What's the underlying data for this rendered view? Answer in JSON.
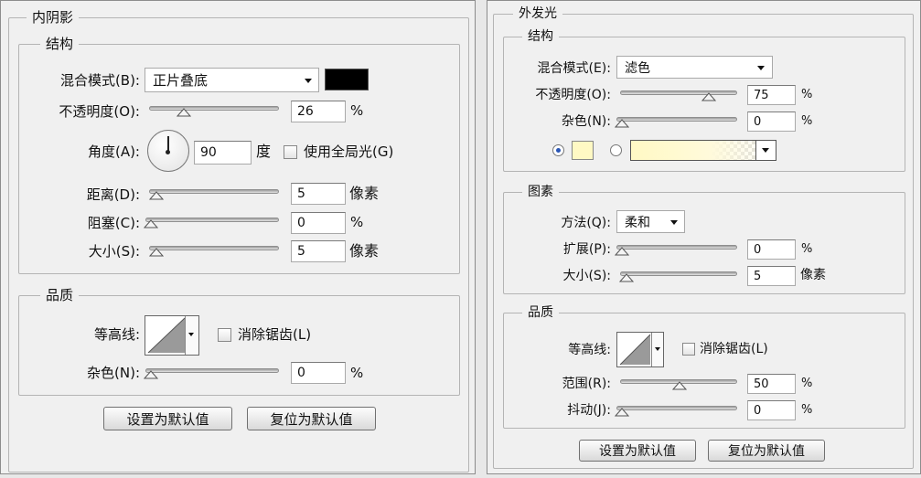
{
  "inner_shadow": {
    "title": "内阴影",
    "structure": {
      "title": "结构",
      "blend_mode_label": "混合模式(B):",
      "blend_mode_value": "正片叠底",
      "shadow_color": "#000000",
      "opacity_label": "不透明度(O):",
      "opacity_value": "26",
      "opacity_unit": "%",
      "angle_label": "角度(A):",
      "angle_value": "90",
      "angle_unit": "度",
      "global_light_label": "使用全局光(G)",
      "distance_label": "距离(D):",
      "distance_value": "5",
      "distance_unit": "像素",
      "choke_label": "阻塞(C):",
      "choke_value": "0",
      "choke_unit": "%",
      "size_label": "大小(S):",
      "size_value": "5",
      "size_unit": "像素"
    },
    "quality": {
      "title": "品质",
      "contour_label": "等高线:",
      "anti_alias_label": "消除锯齿(L)",
      "noise_label": "杂色(N):",
      "noise_value": "0",
      "noise_unit": "%"
    },
    "buttons": {
      "make_default": "设置为默认值",
      "reset_default": "复位为默认值"
    }
  },
  "outer_glow": {
    "title": "外发光",
    "structure": {
      "title": "结构",
      "blend_mode_label": "混合模式(E):",
      "blend_mode_value": "滤色",
      "opacity_label": "不透明度(O):",
      "opacity_value": "75",
      "opacity_unit": "%",
      "noise_label": "杂色(N):",
      "noise_value": "0",
      "noise_unit": "%",
      "glow_color": "#fff9c4"
    },
    "elements": {
      "title": "图素",
      "technique_label": "方法(Q):",
      "technique_value": "柔和",
      "spread_label": "扩展(P):",
      "spread_value": "0",
      "spread_unit": "%",
      "size_label": "大小(S):",
      "size_value": "5",
      "size_unit": "像素"
    },
    "quality": {
      "title": "品质",
      "contour_label": "等高线:",
      "anti_alias_label": "消除锯齿(L)",
      "range_label": "范围(R):",
      "range_value": "50",
      "range_unit": "%",
      "jitter_label": "抖动(J):",
      "jitter_value": "0",
      "jitter_unit": "%"
    },
    "buttons": {
      "make_default": "设置为默认值",
      "reset_default": "复位为默认值"
    }
  }
}
